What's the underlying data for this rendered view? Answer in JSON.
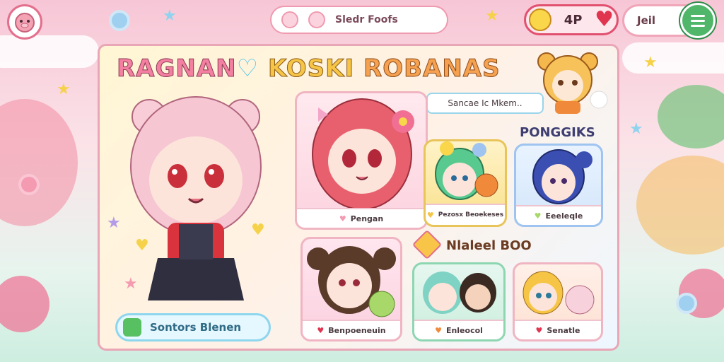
{
  "header": {
    "search_text": "Sledr Foofs",
    "currency_value": "4P",
    "user_name": "Jeil"
  },
  "panel": {
    "title_parts": [
      "RAGNAN",
      "♡",
      "KOSKI",
      "ROBANAS"
    ],
    "subtitle": "Sancae Ic Mkem..",
    "main_button_label": "Sontors Blenen",
    "sections": {
      "right_top_title": "PONGGIKS",
      "right_bottom_title": "Nlaleel BOO"
    },
    "cards": {
      "center_top_label": "Pengan",
      "small_1_label": "Pezosx Beoekeses",
      "small_2_label": "Eeeleqle",
      "center_bottom_label": "Benpoeneuin",
      "small_3_label": "Enleocol",
      "small_4_label": "Senatle"
    }
  },
  "icons": {
    "avatar": "pig-avatar-icon",
    "menu": "hamburger-menu-icon",
    "heart": "heart-icon",
    "coin": "coin-icon"
  },
  "colors": {
    "accent_pink": "#e2506f",
    "accent_green": "#4fb66a",
    "accent_blue": "#8ed6ee"
  }
}
